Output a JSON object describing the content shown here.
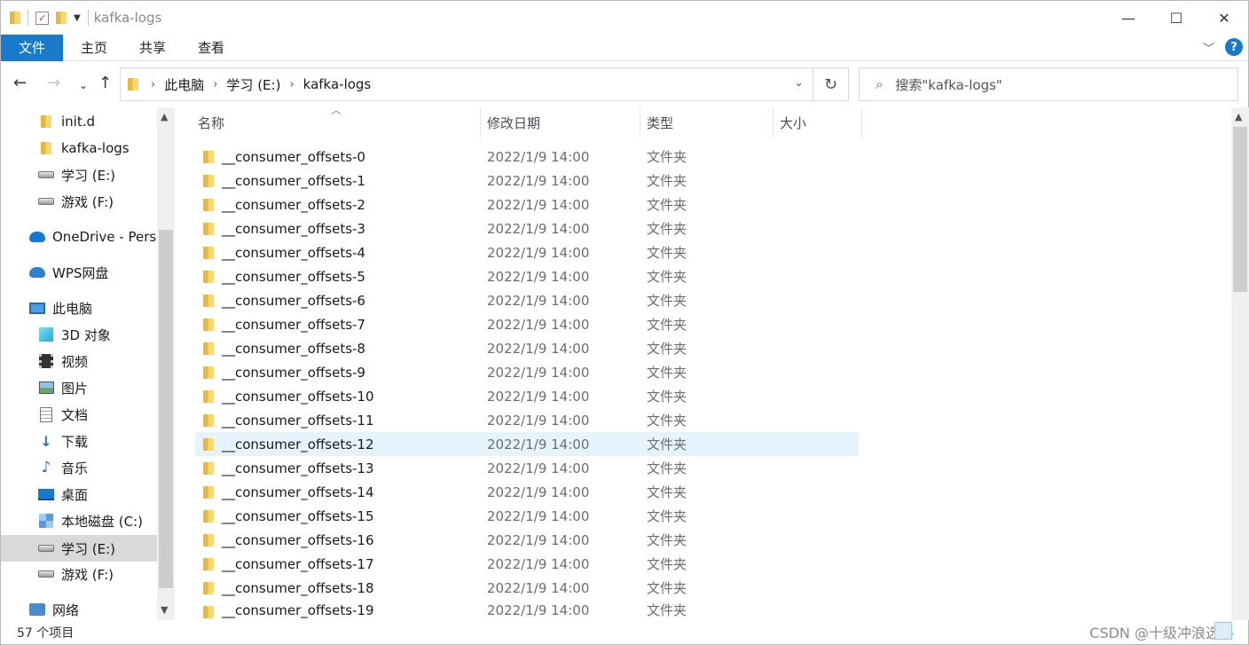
{
  "window": {
    "title": "kafka-logs",
    "controls": {
      "minimize": "—",
      "maximize": "☐",
      "close": "✕"
    }
  },
  "ribbon": {
    "tabs": [
      "文件",
      "主页",
      "共享",
      "查看"
    ],
    "help": "?"
  },
  "address": {
    "crumbs": [
      "此电脑",
      "学习 (E:)",
      "kafka-logs"
    ],
    "search_placeholder": "搜索\"kafka-logs\""
  },
  "sidebar": {
    "items": [
      {
        "label": "init.d",
        "icon": "folder-icon"
      },
      {
        "label": "kafka-logs",
        "icon": "folder-icon"
      },
      {
        "label": "学习 (E:)",
        "icon": "drive-icon"
      },
      {
        "label": "游戏 (F:)",
        "icon": "drive-icon"
      },
      {
        "label": "OneDrive - Personal",
        "icon": "onedrive-icon"
      },
      {
        "label": "WPS网盘",
        "icon": "cloud-icon"
      },
      {
        "label": "此电脑",
        "icon": "computer-icon"
      },
      {
        "label": "3D 对象",
        "icon": "3d-objects-icon"
      },
      {
        "label": "视频",
        "icon": "video-icon"
      },
      {
        "label": "图片",
        "icon": "pictures-icon"
      },
      {
        "label": "文档",
        "icon": "documents-icon"
      },
      {
        "label": "下载",
        "icon": "download-icon"
      },
      {
        "label": "音乐",
        "icon": "music-icon"
      },
      {
        "label": "桌面",
        "icon": "desktop-icon"
      },
      {
        "label": "本地磁盘 (C:)",
        "icon": "windows-drive-icon"
      },
      {
        "label": "学习 (E:)",
        "icon": "drive-icon"
      },
      {
        "label": "游戏 (F:)",
        "icon": "drive-icon"
      },
      {
        "label": "网络",
        "icon": "network-icon"
      }
    ]
  },
  "columns": {
    "name": "名称",
    "modified": "修改日期",
    "type": "类型",
    "size": "大小"
  },
  "files": [
    {
      "name": "__consumer_offsets-0",
      "date": "2022/1/9 14:00",
      "type": "文件夹"
    },
    {
      "name": "__consumer_offsets-1",
      "date": "2022/1/9 14:00",
      "type": "文件夹"
    },
    {
      "name": "__consumer_offsets-2",
      "date": "2022/1/9 14:00",
      "type": "文件夹"
    },
    {
      "name": "__consumer_offsets-3",
      "date": "2022/1/9 14:00",
      "type": "文件夹"
    },
    {
      "name": "__consumer_offsets-4",
      "date": "2022/1/9 14:00",
      "type": "文件夹"
    },
    {
      "name": "__consumer_offsets-5",
      "date": "2022/1/9 14:00",
      "type": "文件夹"
    },
    {
      "name": "__consumer_offsets-6",
      "date": "2022/1/9 14:00",
      "type": "文件夹"
    },
    {
      "name": "__consumer_offsets-7",
      "date": "2022/1/9 14:00",
      "type": "文件夹"
    },
    {
      "name": "__consumer_offsets-8",
      "date": "2022/1/9 14:00",
      "type": "文件夹"
    },
    {
      "name": "__consumer_offsets-9",
      "date": "2022/1/9 14:00",
      "type": "文件夹"
    },
    {
      "name": "__consumer_offsets-10",
      "date": "2022/1/9 14:00",
      "type": "文件夹"
    },
    {
      "name": "__consumer_offsets-11",
      "date": "2022/1/9 14:00",
      "type": "文件夹"
    },
    {
      "name": "__consumer_offsets-12",
      "date": "2022/1/9 14:00",
      "type": "文件夹"
    },
    {
      "name": "__consumer_offsets-13",
      "date": "2022/1/9 14:00",
      "type": "文件夹"
    },
    {
      "name": "__consumer_offsets-14",
      "date": "2022/1/9 14:00",
      "type": "文件夹"
    },
    {
      "name": "__consumer_offsets-15",
      "date": "2022/1/9 14:00",
      "type": "文件夹"
    },
    {
      "name": "__consumer_offsets-16",
      "date": "2022/1/9 14:00",
      "type": "文件夹"
    },
    {
      "name": "__consumer_offsets-17",
      "date": "2022/1/9 14:00",
      "type": "文件夹"
    },
    {
      "name": "__consumer_offsets-18",
      "date": "2022/1/9 14:00",
      "type": "文件夹"
    },
    {
      "name": "__consumer_offsets-19",
      "date": "2022/1/9 14:00",
      "type": "文件夹"
    }
  ],
  "status": {
    "count": "57 个项目"
  },
  "watermark": "CSDN @十级冲浪选手"
}
